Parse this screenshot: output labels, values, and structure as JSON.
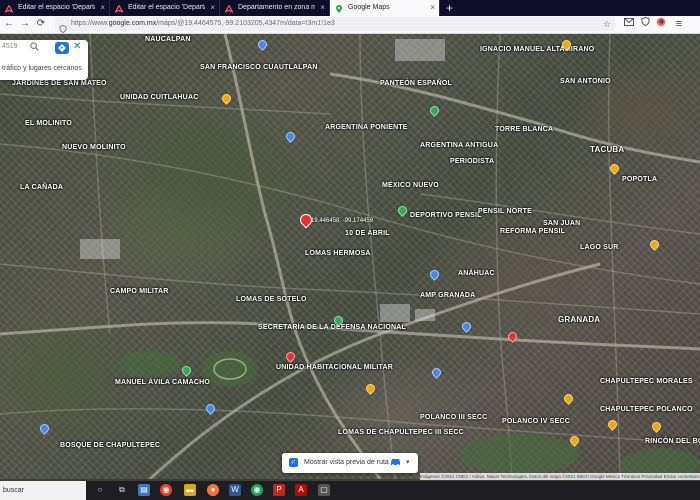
{
  "browser": {
    "tabs": [
      {
        "label": "Editar el espacio 'Departamento",
        "icon": "airbnb-icon",
        "active": false
      },
      {
        "label": "Editar el espacio 'Departamento",
        "icon": "airbnb-icon",
        "active": false
      },
      {
        "label": "Departamento en zona muy se",
        "icon": "airbnb-icon",
        "active": false
      },
      {
        "label": "Google Maps",
        "icon": "maps-pin-icon",
        "active": true
      }
    ],
    "new_tab": "+",
    "url_prefix": "https://www.",
    "url_host": "google.com.mx",
    "url_rest": "/maps/@19.4464575,-99.2103205,4347m/data=!3m1!1e3",
    "controls": {
      "back": "←",
      "forward": "→",
      "reload": "⟳"
    }
  },
  "search": {
    "value": "4519",
    "placeholder": "tráfico y lugares cercanos"
  },
  "map": {
    "selected_coord": "19.446458, -99.174459",
    "areas": [
      "NAUCALPAN",
      "SAN FRANCISCO CUAUTLALPAN",
      "JARDINES DE SAN MATEO",
      "UNIDAD CUITLAHUAC",
      "IGNACIO MANUEL ALTAMIRANO",
      "PANTEÓN ESPAÑOL",
      "EL MOLINITO",
      "SAN ANTONIO",
      "ARGENTINA PONIENTE",
      "ARGENTINA ANTIGUA",
      "TORRE BLANCA",
      "TACUBA",
      "NUEVO MOLINITO",
      "LA CAÑADA",
      "MÉXICO NUEVO",
      "POPOTLA",
      "PERIODISTA",
      "DEPORTIVO PENSIL",
      "PENSIL NORTE",
      "SAN JUAN",
      "10 DE ABRIL",
      "LOMAS HERMOSA",
      "REFORMA PENSIL",
      "LAGO SUR",
      "CAMPO MILITAR",
      "ANÁHUAC",
      "LOMAS DE SOTELO",
      "AMP GRANADA",
      "GRANADA",
      "UNIDAD HABITACIONAL MILITAR",
      "SECRETARÍA DE LA DEFENSA NACIONAL",
      "MANUEL ÁVILA CAMACHO",
      "POLANCO III SECC",
      "POLANCO IV SECC",
      "CHAPULTEPEC MORALES",
      "LOMAS DE CHAPULTEPEC III SECC",
      "CHAPULTEPEC POLANCO",
      "RINCÓN DEL BOSQUE",
      "BOSQUE DE CHAPULTEPEC"
    ]
  },
  "route_preview": {
    "label": "Mostrar vista previa de ruta",
    "caret": "▾"
  },
  "attribution": "Imágenes ©2021 CNES / Airbus, Maxar Technologies, Datos del mapa ©2021 INEGI  Google  México  Términos  Privacidad  Enviar comentarios  1 km",
  "taskbar": {
    "search_label": "buscar"
  }
}
